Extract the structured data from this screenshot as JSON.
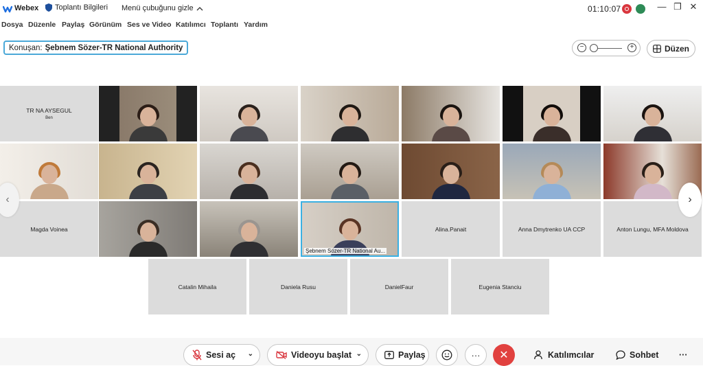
{
  "titlebar": {
    "app_name": "Webex",
    "meeting_info": "Toplantı Bilgileri",
    "hide_menu": "Menü çubuğunu gizle",
    "time": "01:10:07",
    "minimize": "—",
    "restore": "❐",
    "close": "✕"
  },
  "menu": {
    "items": [
      "Dosya",
      "Düzenle",
      "Paylaş",
      "Görünüm",
      "Ses ve Video",
      "Katılımcı",
      "Toplantı",
      "Yardım"
    ]
  },
  "speaker": {
    "prefix": "Konuşan:",
    "name": "Şebnem Sözer-TR National Authority"
  },
  "layout_button": {
    "label": "Düzen"
  },
  "tiles": {
    "r1c1": {
      "name": "TR NA AYSEGUL",
      "sub": "Ben"
    },
    "r3c1": {
      "name": "Magda Voinea"
    },
    "r3c3_caption": "Şebnem Sözer-TR National Au...",
    "r3c4": {
      "name": "Alina.Panait"
    },
    "r3c5": {
      "name": "Anna Dmytrenko UA CCP"
    },
    "r3c6": {
      "name": "Anton Lungu, MFA Moldova"
    },
    "r4c1": {
      "name": "Catalin Mihaila"
    },
    "r4c2": {
      "name": "Daniela Rusu"
    },
    "r4c3": {
      "name": "DanielFaur"
    },
    "r4c4": {
      "name": "Eugenia Stanciu"
    }
  },
  "controls": {
    "audio": "Sesi aç",
    "video": "Videoyu başlat",
    "share": "Paylaş",
    "participants": "Katılımcılar",
    "chat": "Sohbet",
    "more": "···"
  },
  "colors": {
    "accent": "#3ab0e2",
    "end_call": "#e1413f",
    "tile_bg": "#dcdcdc",
    "muted_icon": "#d9363e"
  }
}
